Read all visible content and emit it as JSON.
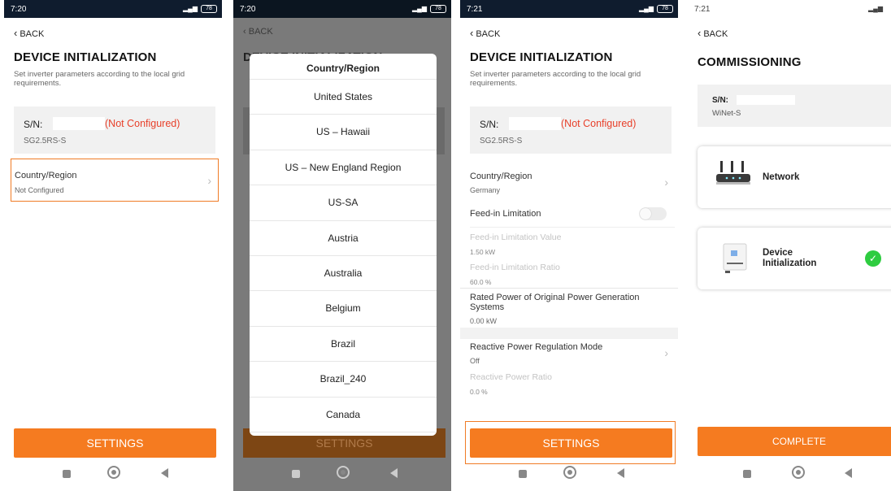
{
  "status_bar": {
    "time_1": "7:20",
    "time_2": "7:20",
    "time_3": "7:21",
    "time_4": "7:21",
    "battery_1": "78",
    "battery_2": "78",
    "battery_3": "78",
    "battery_4": "78"
  },
  "screen1": {
    "back": "BACK",
    "title": "DEVICE INITIALIZATION",
    "description": "Set inverter parameters according to the local grid requirements.",
    "sn_label": "S/N:",
    "sn_status": "(Not Configured)",
    "model": "SG2.5RS-S",
    "country_label": "Country/Region",
    "country_value": "Not Configured",
    "settings_button": "SETTINGS"
  },
  "screen2": {
    "back": "BACK",
    "title_fragment": "DEVICE INITIALIZATION",
    "modal_title": "Country/Region",
    "options": [
      "United States",
      "US – Hawaii",
      "US – New England Region",
      "US-SA",
      "Austria",
      "Australia",
      "Belgium",
      "Brazil",
      "Brazil_240",
      "Canada"
    ],
    "settings_button": "SETTINGS"
  },
  "screen3": {
    "back": "BACK",
    "title": "DEVICE INITIALIZATION",
    "description": "Set inverter parameters according to the local grid requirements.",
    "sn_label": "S/N:",
    "sn_status": "(Not Configured)",
    "model": "SG2.5RS-S",
    "country_label": "Country/Region",
    "country_value": "Germany",
    "feed_in_label": "Feed-in Limitation",
    "feed_value_label": "Feed-in Limitation Value",
    "feed_value": "1.50 kW",
    "feed_ratio_label": "Feed-in Limitation Ratio",
    "feed_ratio": "60.0 %",
    "rated_label": "Rated Power of Original Power Generation Systems",
    "rated_value": "0.00 kW",
    "reactive_mode_label": "Reactive Power Regulation Mode",
    "reactive_mode_value": "Off",
    "reactive_ratio_label": "Reactive Power Ratio",
    "reactive_ratio_value": "0.0 %",
    "settings_button": "SETTINGS"
  },
  "screen4": {
    "back": "BACK",
    "title": "COMMISSIONING",
    "sn_label": "S/N:",
    "sn_model": "WiNet-S",
    "network_label": "Network",
    "device_init_label_1": "Device",
    "device_init_label_2": "Initialization",
    "complete_button": "COMPLETE"
  },
  "colors": {
    "accent": "#f57b20",
    "error": "#e8402a",
    "success": "#2ecc40",
    "status_bar": "#0f1c2e"
  }
}
